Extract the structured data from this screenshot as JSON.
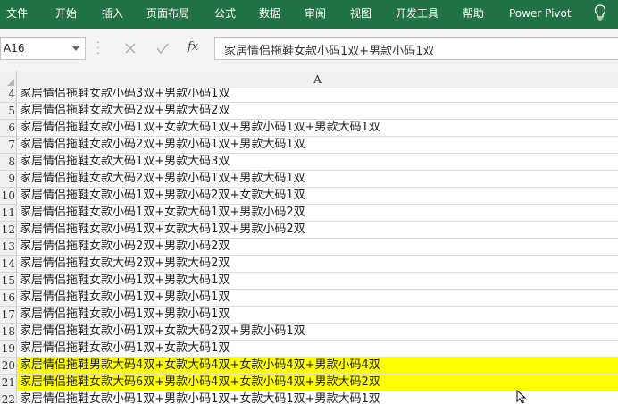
{
  "ribbon": {
    "tabs": [
      "文件",
      "开始",
      "插入",
      "页面布局",
      "公式",
      "数据",
      "审阅",
      "视图",
      "开发工具",
      "帮助",
      "Power Pivot"
    ],
    "background": "#217346"
  },
  "formula_bar": {
    "name_box": "A16",
    "fx_label": "fx",
    "formula": "家居情侣拖鞋女款小码1双+男款小码1双"
  },
  "sheet": {
    "column_header": "A",
    "highlight_color": "#ffff00",
    "rows": [
      {
        "num": "4",
        "text": "家居情侣拖鞋女款小码3双+男款小码1双",
        "highlight": false
      },
      {
        "num": "5",
        "text": "家居情侣拖鞋女款大码2双+男款大码2双",
        "highlight": false
      },
      {
        "num": "6",
        "text": "家居情侣拖鞋女款小码1双+女款大码1双+男款小码1双+男款大码1双",
        "highlight": false
      },
      {
        "num": "7",
        "text": "家居情侣拖鞋女款小码2双+男款小码1双+男款大码1双",
        "highlight": false
      },
      {
        "num": "8",
        "text": "家居情侣拖鞋女款大码1双+男款大码3双",
        "highlight": false
      },
      {
        "num": "9",
        "text": "家居情侣拖鞋女款大码2双+男款小码1双+男款大码1双",
        "highlight": false
      },
      {
        "num": "10",
        "text": "家居情侣拖鞋女款小码1双+男款小码2双+女款大码1双",
        "highlight": false
      },
      {
        "num": "11",
        "text": "家居情侣拖鞋女款小码1双+女款大码1双+男款小码2双",
        "highlight": false
      },
      {
        "num": "12",
        "text": "家居情侣拖鞋女款小码1双+女款大码1双+男款小码2双",
        "highlight": false
      },
      {
        "num": "13",
        "text": "家居情侣拖鞋女款小码2双+男款小码2双",
        "highlight": false
      },
      {
        "num": "14",
        "text": "家居情侣拖鞋女款大码2双+男款大码2双",
        "highlight": false
      },
      {
        "num": "15",
        "text": "家居情侣拖鞋女款小码1双+男款大码1双",
        "highlight": false
      },
      {
        "num": "16",
        "text": "家居情侣拖鞋女款小码1双+男款小码1双",
        "highlight": false
      },
      {
        "num": "17",
        "text": "家居情侣拖鞋女款小码1双+男款小码1双",
        "highlight": false
      },
      {
        "num": "18",
        "text": "家居情侣拖鞋女款小码1双+女款大码2双+男款小码1双",
        "highlight": false
      },
      {
        "num": "19",
        "text": "家居情侣拖鞋女款小码1双+女款大码1双",
        "highlight": false
      },
      {
        "num": "20",
        "text": "家居情侣拖鞋男款大码4双+女款大码4双+女款小码4双+男款小码4双",
        "highlight": true
      },
      {
        "num": "21",
        "text": "家居情侣拖鞋女款大码6双+男款小码4双+女款小码4双+男款大码2双",
        "highlight": true
      },
      {
        "num": "22",
        "text": "家居情侣拖鞋女款小码1双+男款小码1双+女款大码1双+男款大码1双",
        "highlight": false
      }
    ]
  }
}
